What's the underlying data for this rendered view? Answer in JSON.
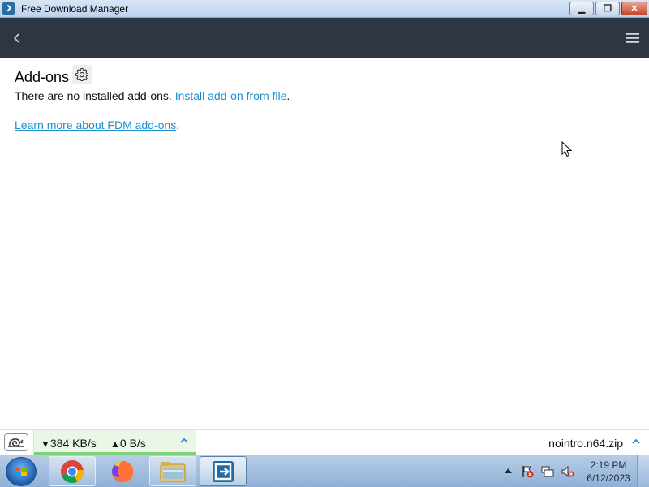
{
  "window": {
    "title": "Free Download Manager",
    "minimize_glyph": "▁",
    "maximize_glyph": "❐",
    "close_glyph": "✕"
  },
  "addons": {
    "title": "Add-ons",
    "no_installed_text": "There are no installed add-ons. ",
    "install_link": "Install add-on from file",
    "period": ".",
    "learn_more_link": "Learn more about FDM add-ons"
  },
  "status": {
    "download_arrow": "▼",
    "download_speed": "384 KB/s",
    "upload_arrow": "▲",
    "upload_speed": "0 B/s",
    "filename": "nointro.n64.zip"
  },
  "taskbar": {
    "time": "2:19 PM",
    "date": "6/12/2023",
    "apps": [
      "chrome-icon",
      "firefox-icon",
      "file-explorer-icon",
      "free-download-manager-icon"
    ]
  },
  "colors": {
    "app_header": "#2e3643",
    "link": "#1d8fcf",
    "speed_bg": "#eaf6e6",
    "speed_bar": "#7fd07a"
  }
}
